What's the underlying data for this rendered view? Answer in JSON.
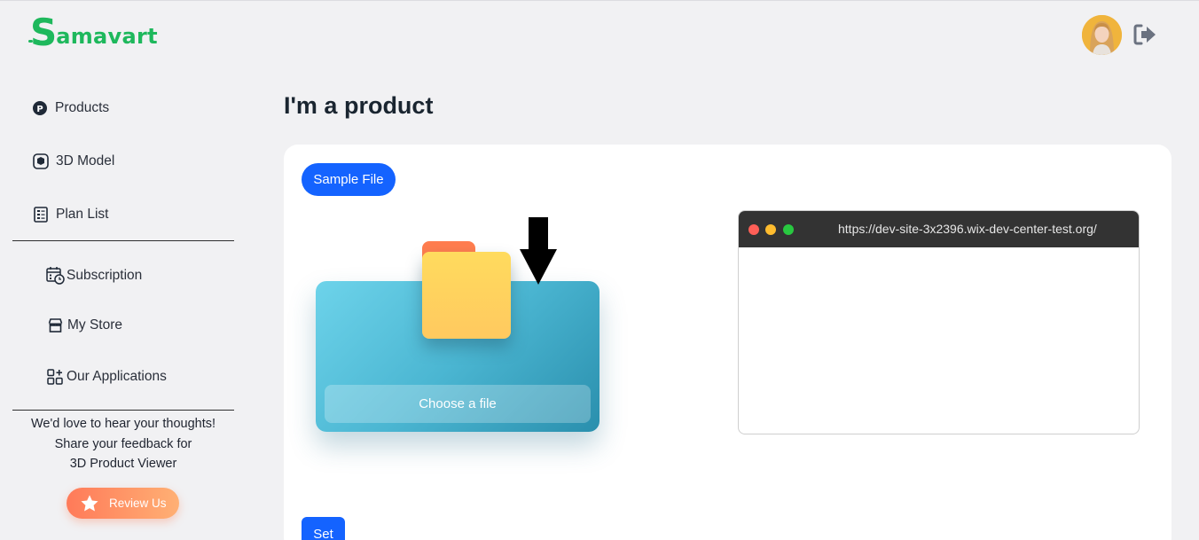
{
  "app": {
    "logo_text": "amavart",
    "logo_letter": "S"
  },
  "sidebar": {
    "items": [
      {
        "label": "Products",
        "icon": "product-p-icon"
      },
      {
        "label": "3D Model",
        "icon": "cube-icon"
      },
      {
        "label": "Plan List",
        "icon": "list-icon"
      },
      {
        "label": "Subscription",
        "icon": "calendar-clock-icon"
      },
      {
        "label": "My Store",
        "icon": "store-icon"
      },
      {
        "label": "Our Applications",
        "icon": "apps-icon"
      }
    ],
    "feedback_text": [
      "We'd love to hear your thoughts!",
      "Share your feedback for",
      "3D Product Viewer"
    ],
    "review_label": "Review Us"
  },
  "main": {
    "title": "I'm a product",
    "sample_file_label": "Sample File",
    "choose_file_label": "Choose a file",
    "preview_url": "https://dev-site-3x2396.wix-dev-center-test.org/",
    "set_label": "Set"
  },
  "colors": {
    "brand_green": "#1eb85c",
    "primary_blue": "#1463ff",
    "review_gradient_start": "#ff7a59",
    "review_gradient_end": "#ffb074"
  }
}
